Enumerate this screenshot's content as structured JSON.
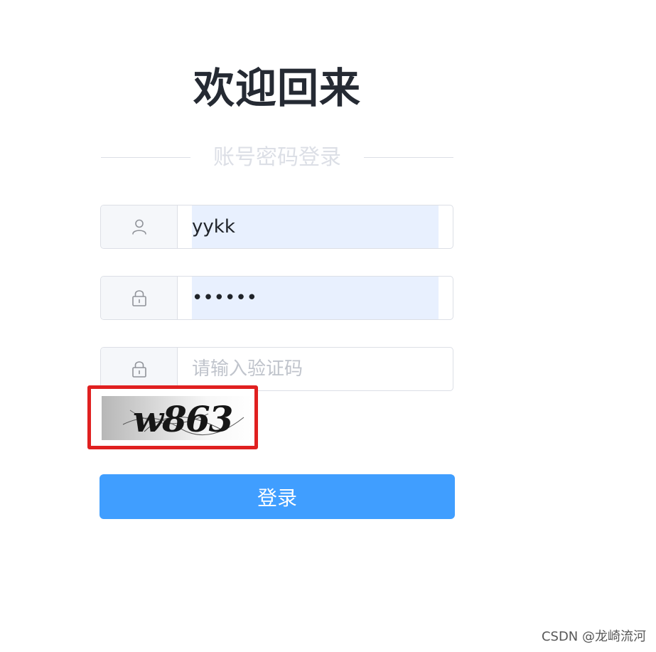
{
  "title": "欢迎回来",
  "login_method": "账号密码登录",
  "username": {
    "value": "yykk",
    "placeholder": "",
    "icon": "user-icon"
  },
  "password": {
    "value": "123456",
    "placeholder": "",
    "icon": "lock-icon"
  },
  "captcha": {
    "value": "",
    "placeholder": "请输入验证码",
    "icon": "lock-icon",
    "image_text": "w863"
  },
  "login_button": "登录",
  "watermark": "CSDN @龙崎流河",
  "colors": {
    "primary": "#409eff",
    "highlight_border": "#e02020",
    "autofill": "#e8f0fe"
  }
}
